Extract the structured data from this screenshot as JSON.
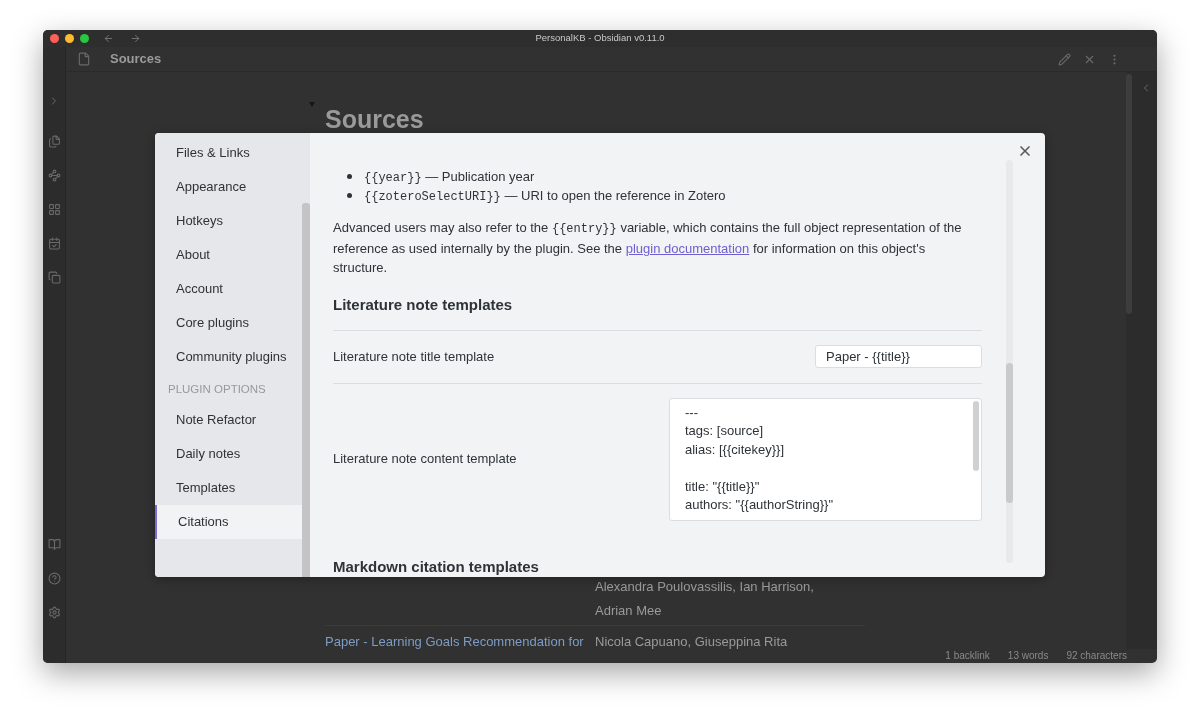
{
  "window": {
    "title": "PersonalKB - Obsidian v0.11.0"
  },
  "tab_header": {
    "title": "Sources"
  },
  "note": {
    "heading": "Sources",
    "table_rows": [
      {
        "authors": "Alexandra Poulovassilis, Ian Harrison, Adrian Mee"
      },
      {
        "title": "Paper - Learning Goals Recommendation for",
        "authors": "Nicola Capuano, Giuseppina Rita"
      }
    ]
  },
  "status_bar": [
    "1 backlink",
    "13 words",
    "92 characters"
  ],
  "settings": {
    "sidebar": {
      "items": [
        {
          "label": "Files & Links",
          "selected": false
        },
        {
          "label": "Appearance",
          "selected": false
        },
        {
          "label": "Hotkeys",
          "selected": false
        },
        {
          "label": "About",
          "selected": false
        },
        {
          "label": "Account",
          "selected": false
        },
        {
          "label": "Core plugins",
          "selected": false
        },
        {
          "label": "Community plugins",
          "selected": false
        }
      ],
      "section_label": "PLUGIN OPTIONS",
      "plugin_items": [
        {
          "label": "Note Refactor",
          "selected": false
        },
        {
          "label": "Daily notes",
          "selected": false
        },
        {
          "label": "Templates",
          "selected": false
        },
        {
          "label": "Citations",
          "selected": true
        }
      ]
    },
    "content": {
      "variables": [
        {
          "code": "{{year}}",
          "text": "— Publication year"
        },
        {
          "code": "{{zoteroSelectURI}}",
          "text": "— URI to open the reference in Zotero"
        }
      ],
      "note": {
        "before": "Advanced users may also refer to the ",
        "code": "{{entry}}",
        "middle": " variable, which contains the full object representation of the reference as used internally by the plugin. See the ",
        "link": "plugin documentation",
        "after": " for information on this object's structure."
      },
      "sections": [
        {
          "heading": "Literature note templates",
          "settings": [
            {
              "kind": "text",
              "label": "Literature note title template",
              "value": "Paper - {{title}}"
            },
            {
              "kind": "textarea",
              "label": "Literature note content template",
              "value": "---\ntags: [source]\nalias: [{{citekey}}]\n\ntitle: \"{{title}}\"\nauthors: \"{{authorString}}\""
            }
          ]
        },
        {
          "heading": "Markdown citation templates"
        }
      ]
    }
  }
}
